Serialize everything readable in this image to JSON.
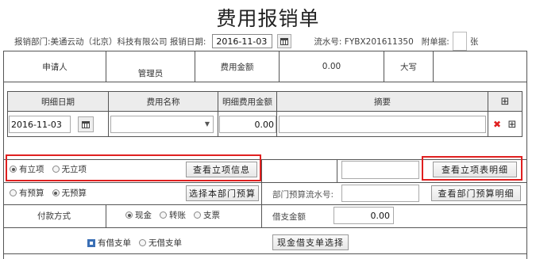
{
  "title": "费用报销单",
  "header": {
    "dept_label": "报销部门:美通云动（北京）科技有限公司 报销日期:",
    "date_value": "2016-11-03",
    "serial_label": "流水号: FYBX201611350",
    "attachments_label": "附单据:",
    "attachments_unit": "张"
  },
  "summary_row": {
    "applicant_label": "申请人",
    "applicant_value": "管理员",
    "amount_label": "费用金额",
    "amount_value": "0.00",
    "capital_label": "大写",
    "capital_value": ""
  },
  "detail_table": {
    "headers": [
      "明细日期",
      "费用名称",
      "明细费用金额",
      "摘要"
    ],
    "add_symbol": "⊞",
    "row": {
      "date": "2016-11-03",
      "name": "",
      "amount": "0.00",
      "summary": ""
    },
    "delete_symbol": "✖",
    "row_add_symbol": "⊞"
  },
  "project": {
    "options": [
      {
        "label": "有立项",
        "selected": true
      },
      {
        "label": "无立项",
        "selected": false
      }
    ],
    "view_button": "查看立项信息",
    "detail_button": "查看立项表明细"
  },
  "budget": {
    "options": [
      {
        "label": "有预算",
        "selected": false
      },
      {
        "label": "无预算",
        "selected": true
      }
    ],
    "select_button": "选择本部门预算",
    "serial_label": "部门预算流水号:",
    "detail_button": "查看部门预算明细"
  },
  "payment": {
    "label": "付款方式",
    "options": [
      {
        "label": "现金",
        "selected": true
      },
      {
        "label": "转账",
        "selected": false
      },
      {
        "label": "支票",
        "selected": false
      }
    ],
    "loan_label": "借支金额",
    "loan_value": "0.00"
  },
  "loan": {
    "has_label": "有借支单",
    "none_label": "无借支单",
    "select_button": "现金借支单选择"
  },
  "colors": {
    "highlight": "#e02020",
    "grid": "#555555",
    "header_bg": "#ececec"
  }
}
